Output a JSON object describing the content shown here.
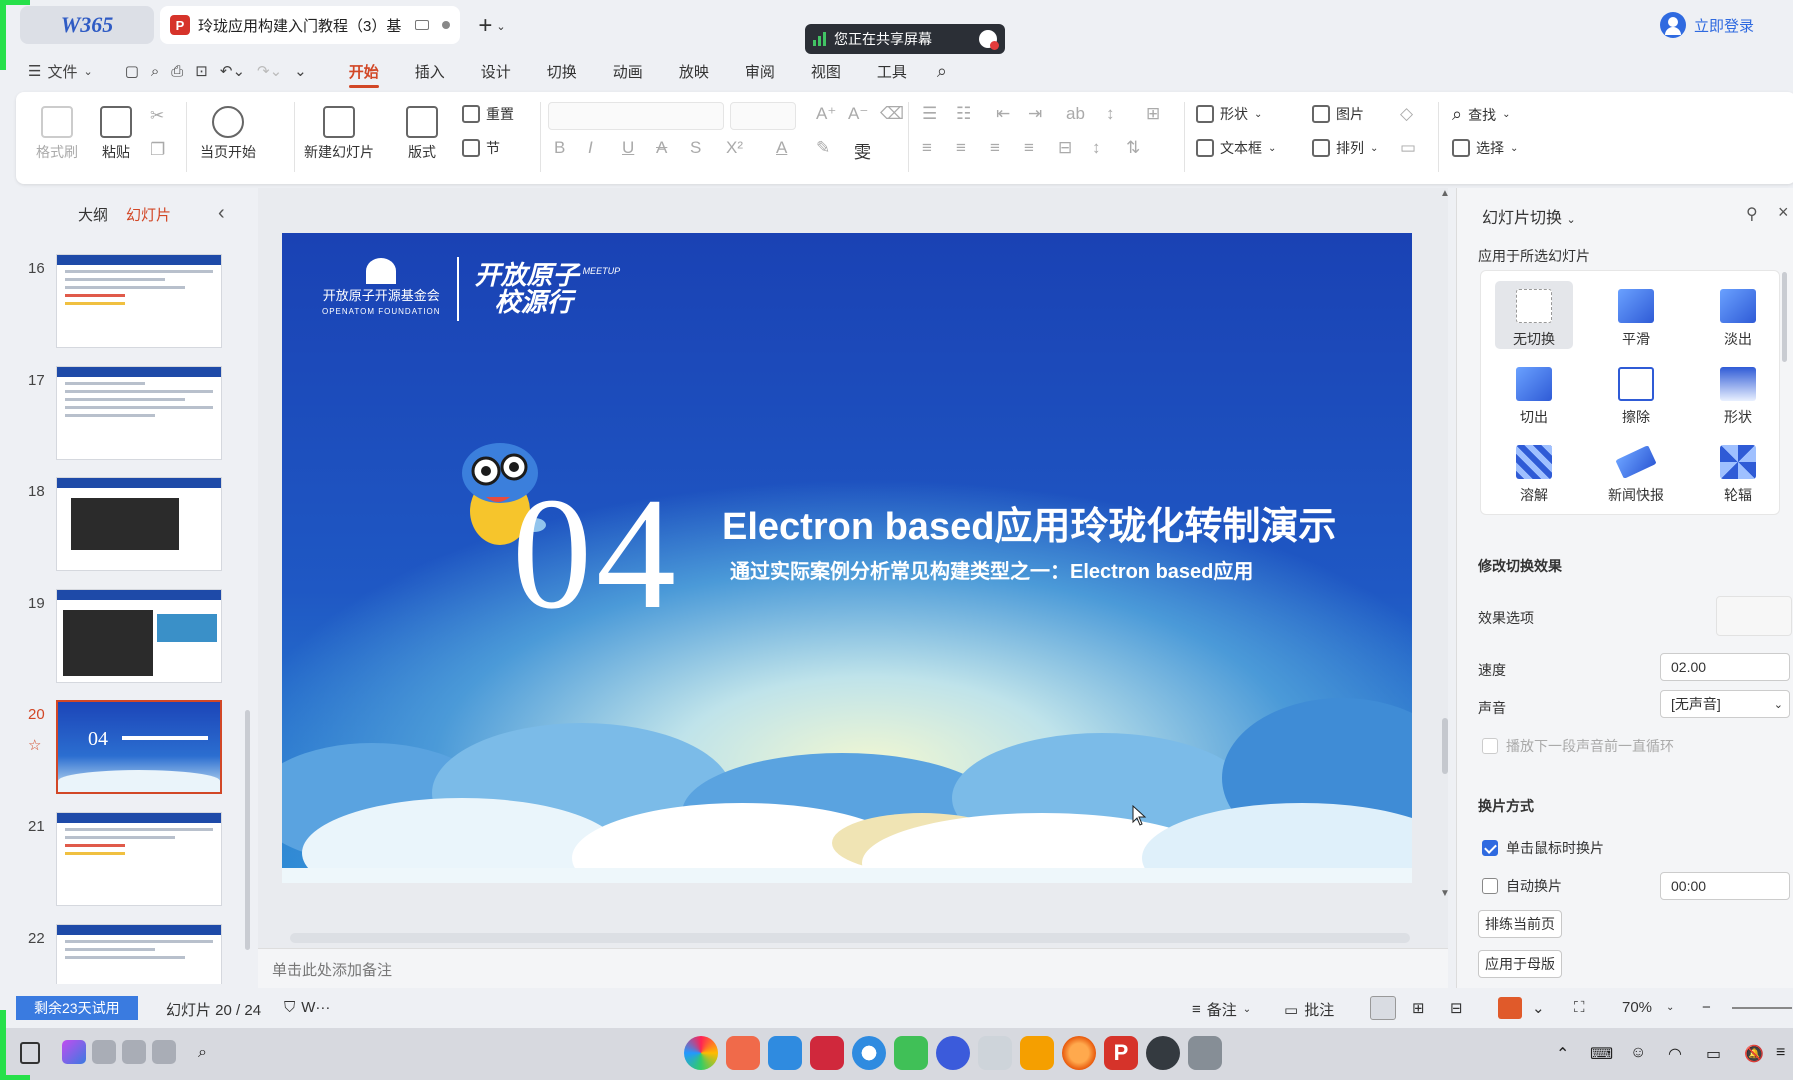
{
  "titlebar": {
    "logo_text": "W365",
    "doc_tab_title": "玲珑应用构建入门教程（3）基",
    "ptag": "P",
    "new_tab": "+",
    "share_banner": "您正在共享屏幕",
    "login": "立即登录"
  },
  "menubar": {
    "hamburger": "☰",
    "file": "文件",
    "tabs": [
      "开始",
      "插入",
      "设计",
      "切换",
      "动画",
      "放映",
      "审阅",
      "视图",
      "工具"
    ],
    "active_tab": "开始"
  },
  "ribbon": {
    "format_painter": "格式刷",
    "paste": "粘贴",
    "slideshow_from_current": "当页开始",
    "new_slide": "新建幻灯片",
    "layout": "版式",
    "reset": "重置",
    "section": "节",
    "shape": "形状",
    "picture": "图片",
    "find": "查找",
    "textbox": "文本框",
    "arrange": "排列",
    "select": "选择",
    "glyphs": {
      "bold": "B",
      "italic": "I",
      "underline": "U",
      "strike": "A",
      "shadow": "S",
      "superscript": "X²",
      "font_color": "A",
      "wen": "雯"
    }
  },
  "left_panel": {
    "tab_outline": "大纲",
    "tab_slides": "幻灯片",
    "collapse": "‹",
    "thumbnails": [
      {
        "num": "16",
        "kind": "text"
      },
      {
        "num": "17",
        "kind": "text"
      },
      {
        "num": "18",
        "kind": "dark"
      },
      {
        "num": "19",
        "kind": "dark"
      },
      {
        "num": "20",
        "kind": "selected"
      },
      {
        "num": "21",
        "kind": "text"
      },
      {
        "num": "22",
        "kind": "text"
      }
    ],
    "star": "☆"
  },
  "slide": {
    "foundation_cn": "开放原子开源基金会",
    "foundation_en": "OPENATOM FOUNDATION",
    "meetup_line1": "开放原子",
    "meetup_line2": "校源行",
    "meetup_tag": "MEETUP",
    "number": "04",
    "title": "Electron based应用玲珑化转制演示",
    "subtitle": "通过实际案例分析常见构建类型之一：Electron based应用"
  },
  "notes_placeholder": "单击此处添加备注",
  "right_pane": {
    "title": "幻灯片切换",
    "apply_to": "应用于所选幻灯片",
    "transitions": [
      "无切换",
      "平滑",
      "淡出",
      "切出",
      "擦除",
      "形状",
      "溶解",
      "新闻快报",
      "轮辐"
    ],
    "selected_transition": "无切换",
    "modify_heading": "修改切换效果",
    "effect_options": "效果选项",
    "speed_label": "速度",
    "speed_value": "02.00",
    "sound_label": "声音",
    "sound_value": "[无声音]",
    "loop_until_next": "播放下一段声音前一直循环",
    "advance_heading": "换片方式",
    "on_click": "单击鼠标时换片",
    "on_click_checked": true,
    "auto_advance": "自动换片",
    "auto_advance_checked": false,
    "auto_time": "00:00",
    "rehearse": "排练当前页",
    "apply_master": "应用于母版"
  },
  "statusbar": {
    "trial": "剩余23天试用",
    "slide_counter": "幻灯片 20 / 24",
    "w_label": "W···",
    "notes": "备注",
    "comments": "批注",
    "zoom": "70%"
  },
  "colors": {
    "accent": "#d24726",
    "blue": "#2f6ae0",
    "slide_bg": "#1f58c4"
  }
}
